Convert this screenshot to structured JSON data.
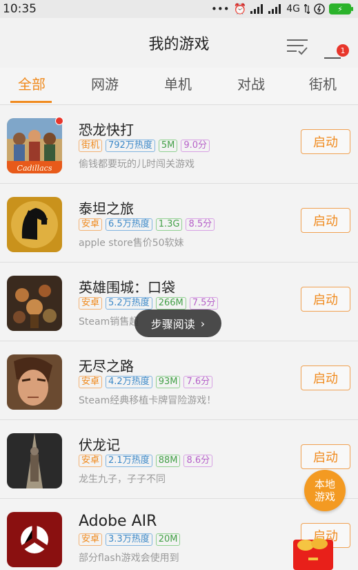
{
  "status_bar": {
    "time": "10:35",
    "dots": "•••",
    "alarm": "⏰",
    "network": "4G",
    "battery_icon": "battery-charging-icon"
  },
  "header": {
    "title": "我的游戏",
    "badge_count": "1"
  },
  "tabs": [
    {
      "label": "全部"
    },
    {
      "label": "网游"
    },
    {
      "label": "单机"
    },
    {
      "label": "对战"
    },
    {
      "label": "街机"
    }
  ],
  "games": [
    {
      "title": "恐龙快打",
      "tag_type": "街机",
      "heat": "792万热度",
      "size": "5M",
      "score": "9.0分",
      "desc": "偷钱都要玩的儿时闯关游戏",
      "launch": "启动"
    },
    {
      "title": "泰坦之旅",
      "tag_type": "安卓",
      "heat": "6.5万热度",
      "size": "1.3G",
      "score": "8.5分",
      "desc": "apple store售价50软妹",
      "launch": "启动"
    },
    {
      "title": "英雄围城：口袋",
      "tag_type": "安卓",
      "heat": "5.2万热度",
      "size": "266M",
      "score": "7.5分",
      "desc": "Steam销售超",
      "launch": "启动"
    },
    {
      "title": "无尽之路",
      "tag_type": "安卓",
      "heat": "4.2万热度",
      "size": "93M",
      "score": "7.6分",
      "desc": "Steam经典移植卡牌冒险游戏！",
      "launch": "启动"
    },
    {
      "title": "伏龙记",
      "tag_type": "安卓",
      "heat": "2.1万热度",
      "size": "88M",
      "score": "8.6分",
      "desc": "龙生九子，子子不同",
      "launch": "启动"
    },
    {
      "title": "Adobe AIR",
      "tag_type": "安卓",
      "heat": "3.3万热度",
      "size": "20M",
      "score": "",
      "desc": "部分flash游戏会使用到",
      "launch": "启动"
    }
  ],
  "toast": {
    "label": "步骤阅读",
    "arrow": "›"
  },
  "local_games": {
    "line1": "本地",
    "line2": "游戏"
  },
  "colors": {
    "accent": "#f08a1d",
    "badge": "#e8362b"
  }
}
